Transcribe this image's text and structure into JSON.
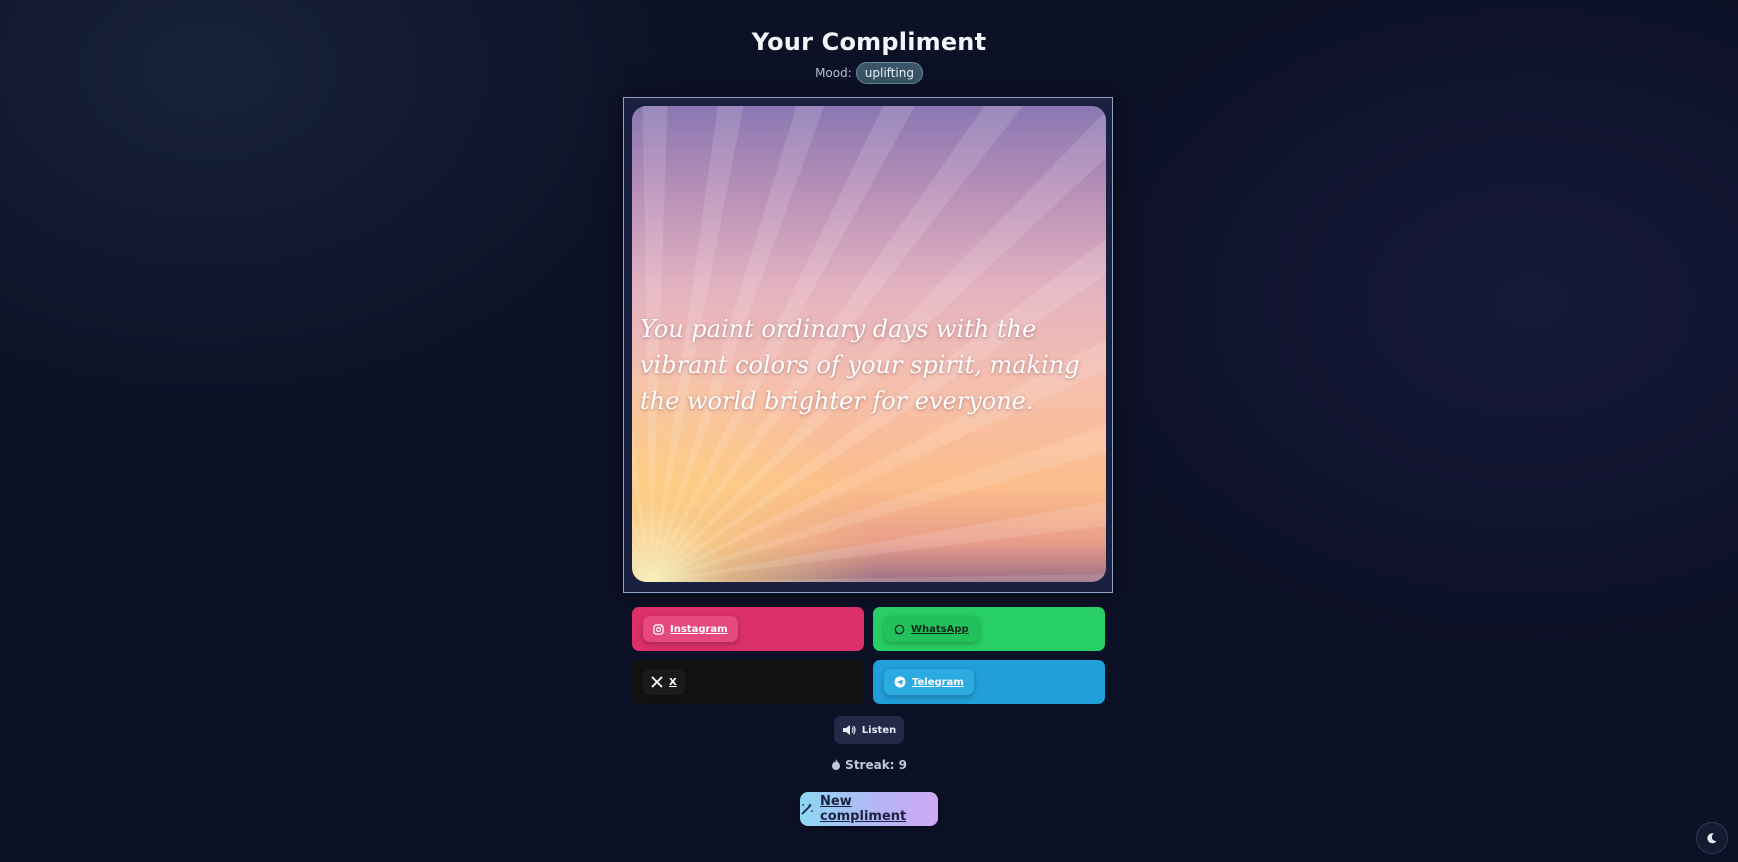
{
  "header": {
    "title": "Your Compliment",
    "mood_label": "Mood:",
    "mood_value": "uplifting"
  },
  "card": {
    "quote": "You paint ordinary days with the vibrant colors of your spirit, making the world brighter for everyone."
  },
  "share": {
    "instagram": "Instagram",
    "whatsapp": "WhatsApp",
    "x": "X",
    "telegram": "Telegram"
  },
  "actions": {
    "listen": "Listen",
    "streak": "Streak: 9",
    "new_compliment": "New compliment"
  },
  "icons": {
    "instagram": "instagram-icon",
    "whatsapp": "whatsapp-icon",
    "x": "x-logo-icon",
    "telegram": "telegram-icon",
    "listen": "speaker-icon",
    "streak": "flame-icon",
    "new": "magic-wand-icon",
    "theme": "moon-icon"
  },
  "colors": {
    "instagram": "#db3069",
    "whatsapp": "#27cf66",
    "x": "#121212",
    "telegram": "#229fd9",
    "background": "#0d1126"
  }
}
